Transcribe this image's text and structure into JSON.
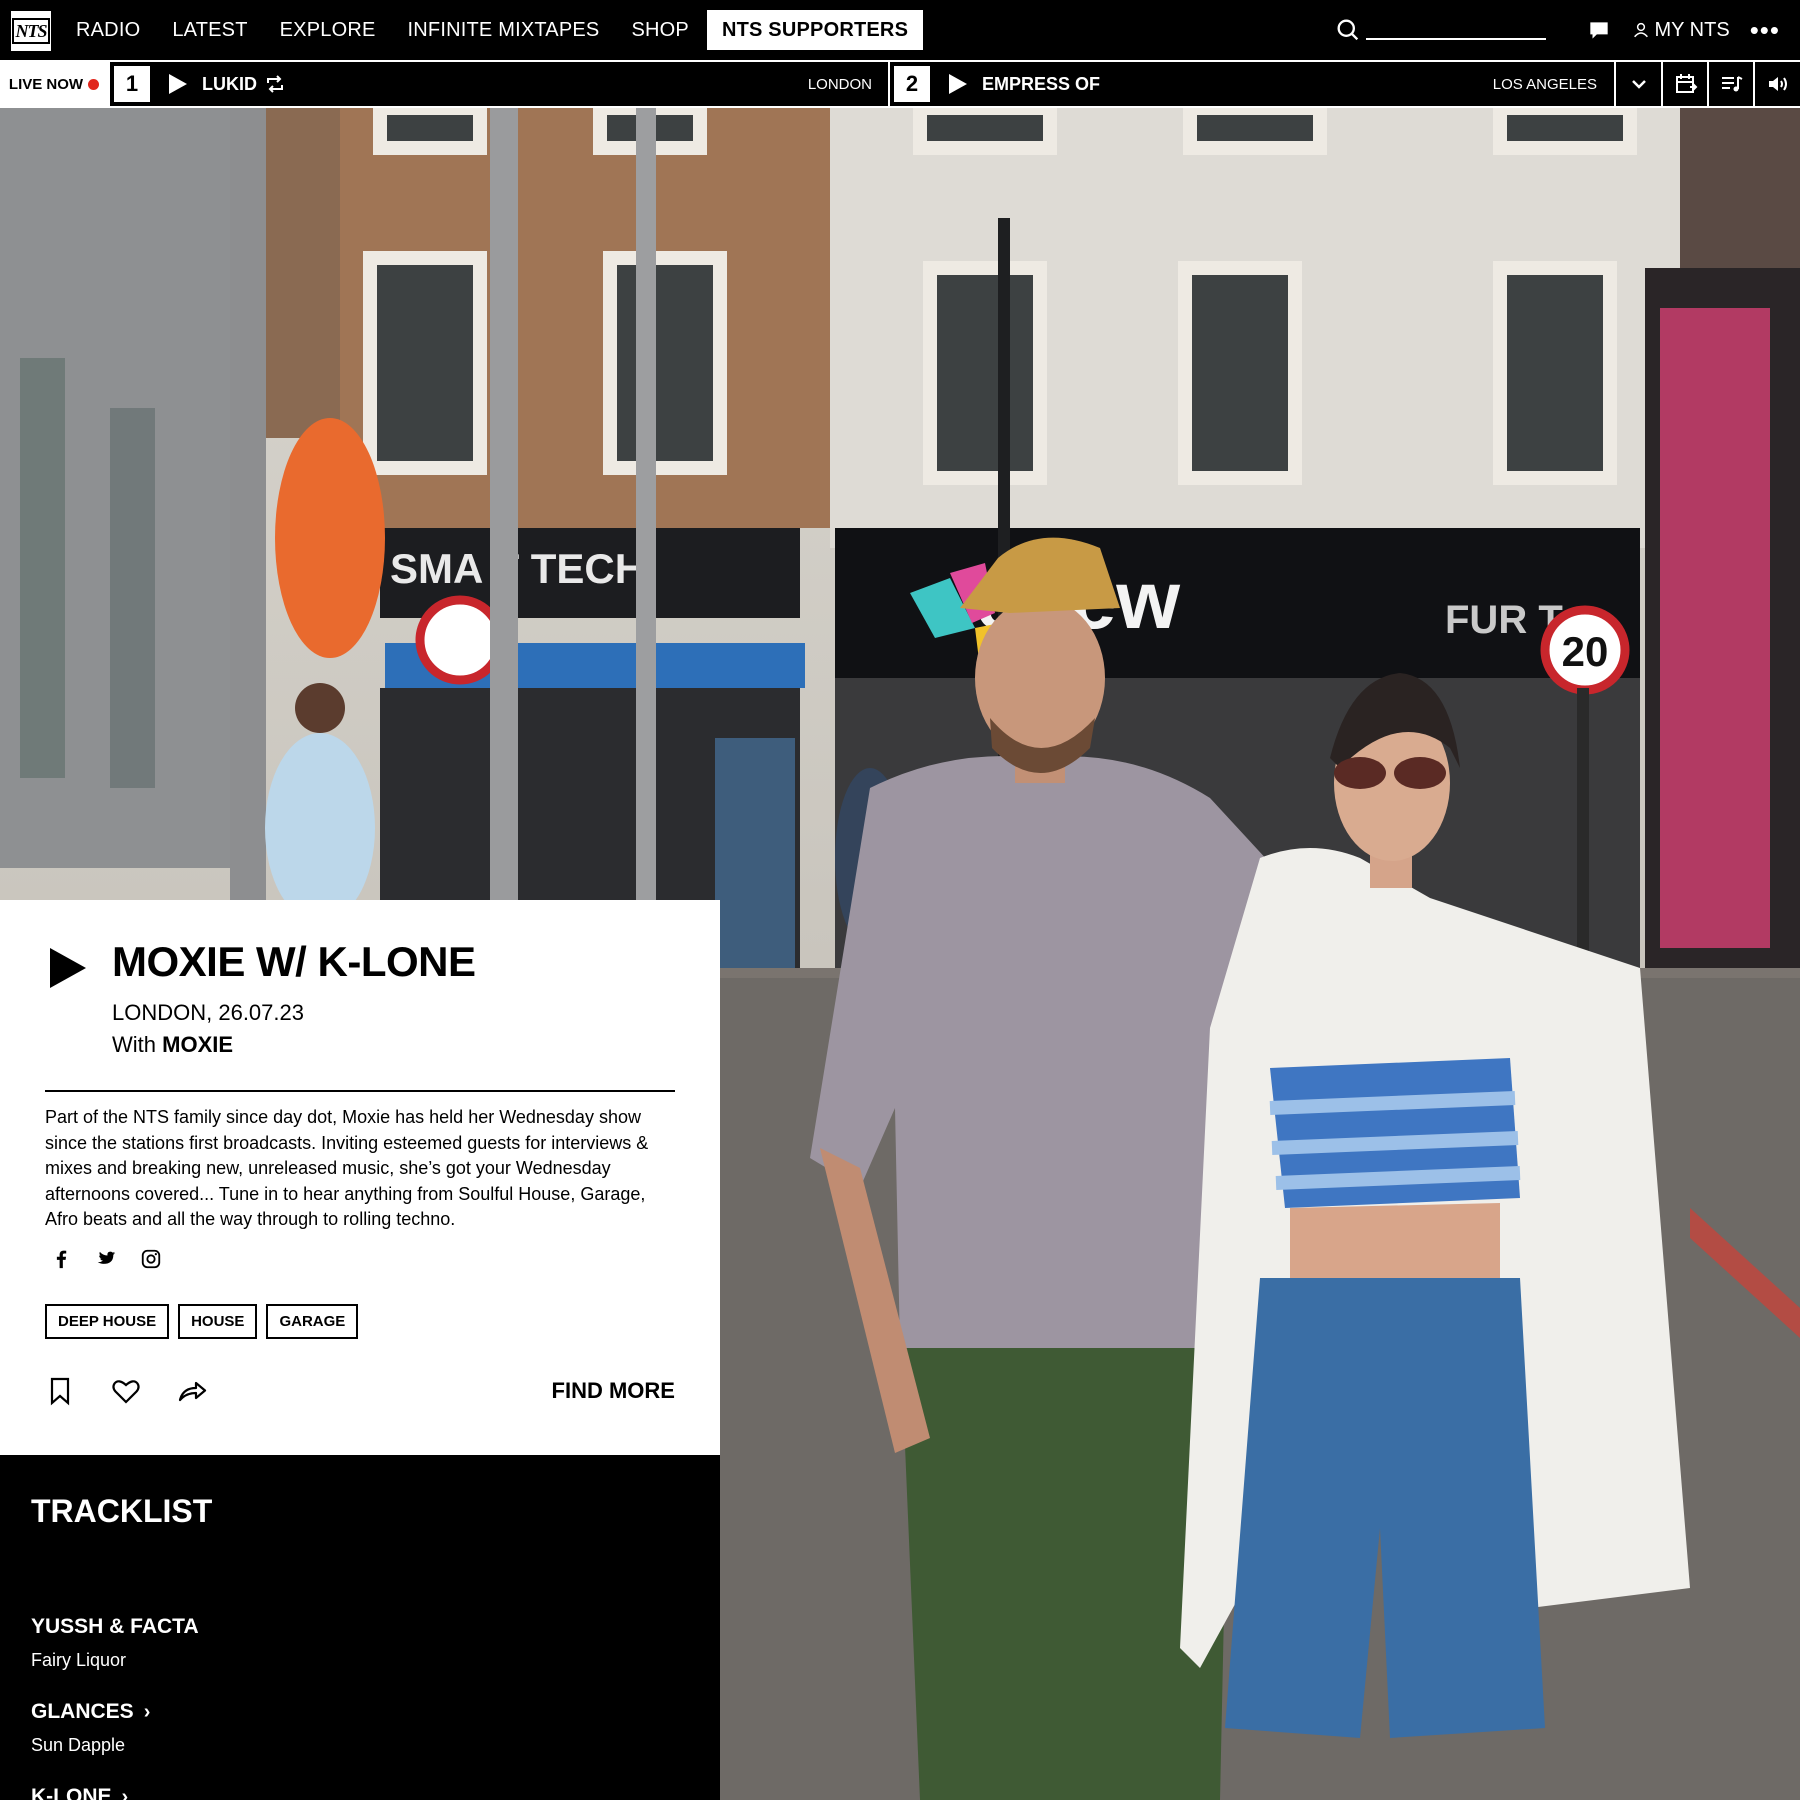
{
  "nav": {
    "logo": "NTS",
    "links": [
      "RADIO",
      "LATEST",
      "EXPLORE",
      "INFINITE MIXTAPES",
      "SHOP"
    ],
    "supporters": "NTS SUPPORTERS",
    "my_nts": "MY NTS",
    "more": "•••"
  },
  "live": {
    "label": "LIVE NOW",
    "channel1": {
      "number": "1",
      "name": "LUKID",
      "location": "LONDON"
    },
    "channel2": {
      "number": "2",
      "name": "EMPRESS OF",
      "location": "LOS ANGELES"
    }
  },
  "show": {
    "title": "MOXIE W/ K-LONE",
    "meta": "LONDON, 26.07.23",
    "with_prefix": "With",
    "host": "MOXIE",
    "description": "Part of the NTS family since day dot, Moxie has held her Wednesday show since the stations first broadcasts. Inviting esteemed guests for interviews & mixes and breaking new, unreleased music, she’s got your Wednesday afternoons covered... Tune in to hear anything from Soulful House, Garage, Afro beats and all the way through to rolling techno.",
    "tags": [
      "DEEP HOUSE",
      "HOUSE",
      "GARAGE"
    ],
    "find_more": "FIND MORE"
  },
  "photo_signage": {
    "shop_left": "SMA  T TECH",
    "shop_right": "eltew",
    "shop_right_2": "FUR   T",
    "speed_sign": "20"
  },
  "tracklist": {
    "title": "TRACKLIST",
    "tracks": [
      {
        "artist": "YUSSH & FACTA",
        "title": "Fairy Liquor"
      },
      {
        "artist": "GLANCES",
        "title": "Sun Dapple"
      },
      {
        "artist": "K-LONE",
        "title": ""
      }
    ]
  }
}
